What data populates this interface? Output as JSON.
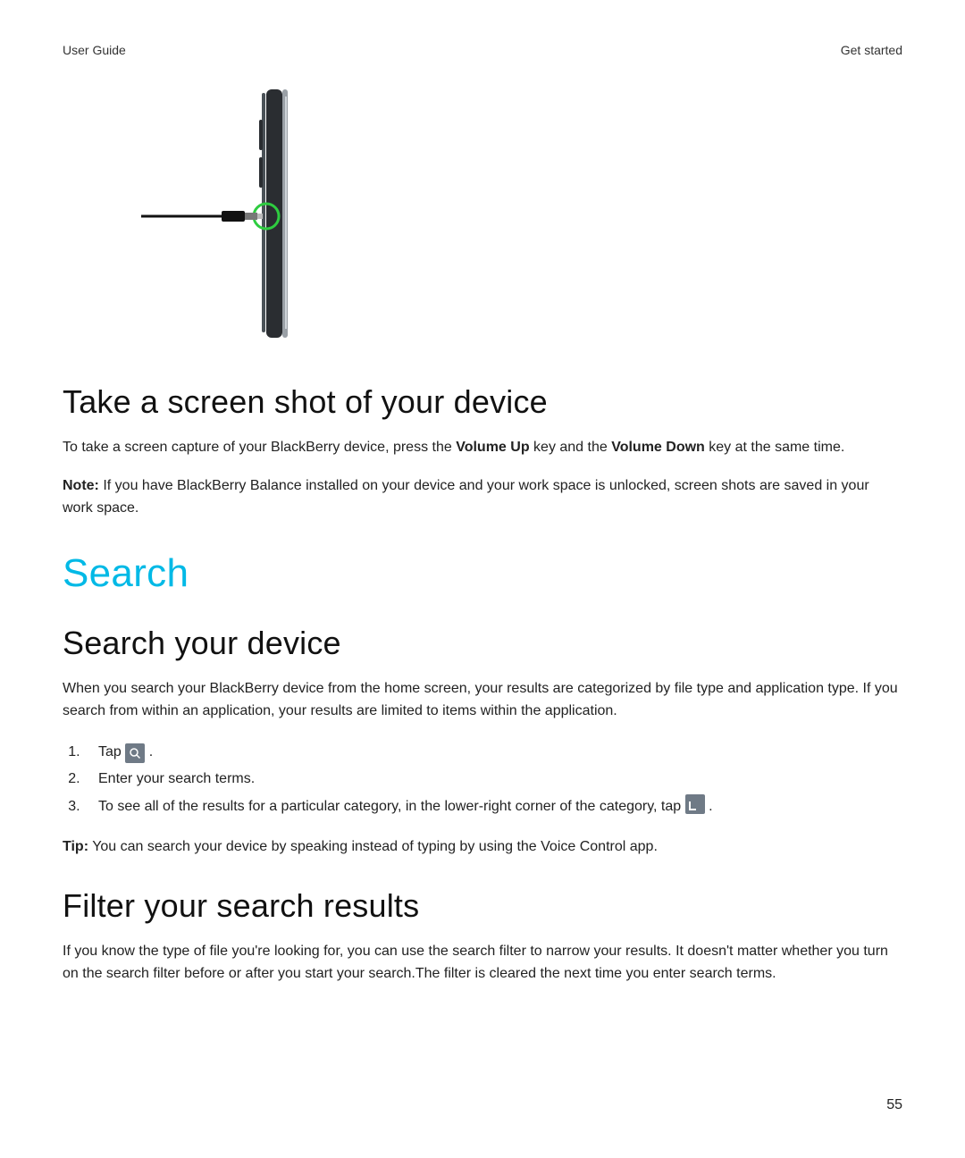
{
  "header": {
    "left": "User Guide",
    "right": "Get started"
  },
  "section1": {
    "title": "Take a screen shot of your device",
    "body_pre": "To take a screen capture of your BlackBerry device, press the ",
    "body_key1": "Volume Up",
    "body_mid": " key and the ",
    "body_key2": "Volume Down",
    "body_post": " key at the same time.",
    "note_label": "Note:",
    "note_text": " If you have BlackBerry Balance installed on your device and your work space is unlocked, screen shots are saved in your work space."
  },
  "section_search": {
    "title": "Search"
  },
  "section2": {
    "title": "Search your device",
    "intro": "When you search your BlackBerry device from the home screen, your results are categorized by file type and application type. If you search from within an application, your results are limited to items within the application.",
    "step1_pre": "Tap ",
    "step1_post": " .",
    "step2": "Enter your search terms.",
    "step3_pre": "To see all of the results for a particular category, in the lower-right corner of the category, tap ",
    "step3_post": " .",
    "tip_label": "Tip:",
    "tip_text": " You can search your device by speaking instead of typing by using the Voice Control app."
  },
  "section3": {
    "title": "Filter your search results",
    "body": "If you know the type of file you're looking for, you can use the search filter to narrow your results. It doesn't matter whether you turn on the search filter before or after you start your search.The filter is cleared the next time you enter search terms."
  },
  "page_number": "55"
}
